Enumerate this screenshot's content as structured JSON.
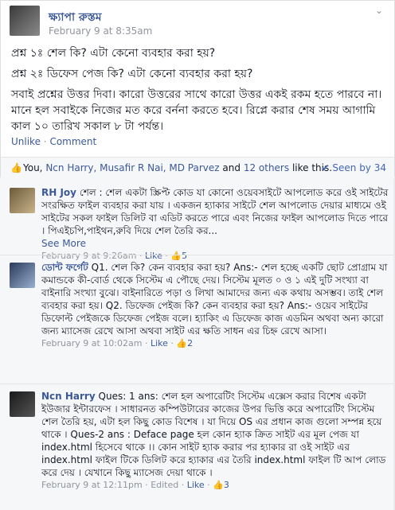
{
  "post": {
    "author": "ক্ষ্যাপা রুস্তম",
    "time": "February 9 at 8:35am",
    "q1": "প্রশ্ন ১ঃ শেল কি? এটা কেনো ব্যবহার করা হয়?",
    "q2": "প্রশ্ন ২ঃ ডিফেস পেজ কি? এটা কেনো ব্যবহার করা হয়?",
    "body": "সবাই প্রশ্নের উত্তর দিবা। কারো উত্তরের সাথে কারো উত্তর একই রকম হতে পারবে না। মানে হল সবাইকে নিজের মত করে বর্ননা করতে হবে। রিপ্লে করার শেষ সময় আগামি কাল ১০ তারিখ সকাল ৮ টা পর্যন্ত।",
    "unlike": "Unlike",
    "dot": "·",
    "comment": "Comment",
    "chevron": "⌄"
  },
  "likes": {
    "thumb": "👍",
    "prefix": "You,",
    "names": "Ncn Harry, Musafir R Nai, MD Parvez",
    "and": "and",
    "others": "12 others",
    "suffix": "like this.",
    "seen": "✔ Seen by 34"
  },
  "comments": [
    {
      "name": "RH Joy",
      "text": "শেল : শেল একটা স্ক্রিপ্ট কোড যা কোনো ওয়েবসাইটে আপলোড করে ওই সাইটের সংরক্ষিত ফাইল ব্যবহার করা যায় । একজন হ্যাকার সাইটে শেল আপলোড দেয়ার মাধ্যমে ওই সাইটের সকল ফাইল ডিলিট বা এডিট করতে পারে এবং নিজের ফাইল আপলোড দিতে পারে । পিএইচপি,পাইথন,রুবি দিয়ে শেল তৈরি কর...",
      "more": "See More",
      "time": "February 9 at 9:26am",
      "like": "Like",
      "likes": "5"
    },
    {
      "name": "ডোন্ট ফর্গেট",
      "text": "Q1. শেল কি? কেন ব্যবহার করা হয়? Ans:- শেল হচ্ছে একটি ছোট প্রোগ্রাম যা কমান্ডকে কী-বোর্ড থেকে সিস্টেম এ পৌছে দেয়। সিস্টেম মূলত ০ ও ১ এই দুটি সংখ্যা বা বাইনারি সংখ্যা বুঝে। বাইনারিতে পড়া ও লিখা আমাদের জন্য এক কথায় অসম্ভব। তাই শেল ব্যবহার করা হয়। Q2. ডিফেজ পেইজ কি? কেন ব্যবহার করা হয়? Ans:- ওয়েব সাইটের ডিফোল্ট পেইজকে ডিফেজ পেইজ বলে। হ্যাকিং এ ডিফেজ কাজ এডমিন অথবা অন্য কারো জন্য ম্যাসেজ রেখে আসা অথবা সাইট এর ক্ষতি সাধন এর চিহ্ন রেখে আসা।",
      "time": "February 9 at 10:02am",
      "like": "Like",
      "likes": "2"
    },
    {
      "name": "Ncn Harry",
      "text": "Ques: 1 ans: শেল হল অপারেটিং সিস্টেম এক্সেস করার বিশেষ একটা ইউজার ইন্টারফেস । সাধারনত কম্পিউটারের কাজের উপর ভিত্তি করে অপারেটিং সিস্টেম শেল তৈরি হয়, এটা হল কিছু কোড বিশেষ । যা দিয়ে OS এর প্রধান কাজ গুলো সম্পন্ন হয়ে থাকে । Ques-2 ans : Deface page হল কোন হ্যাক ক্রিত সাইট এর মূল পেজ যা index.html হিসেবে থাকে ।। কোন সাইট হ্যাক করার পর হ্যাকার রা ওই সাইট এর index.html ফাইল টিকে ডিলিট করে হ্যাকার এর তৈরি index.html ফাইল টি আপ লোড করে দেয় । যেখানে কিছু ম্যাসেজ দেয়া থাকে ।",
      "time": "February 9 at 12:11pm",
      "edited": "Edited",
      "like": "Like",
      "likes": "3"
    }
  ]
}
